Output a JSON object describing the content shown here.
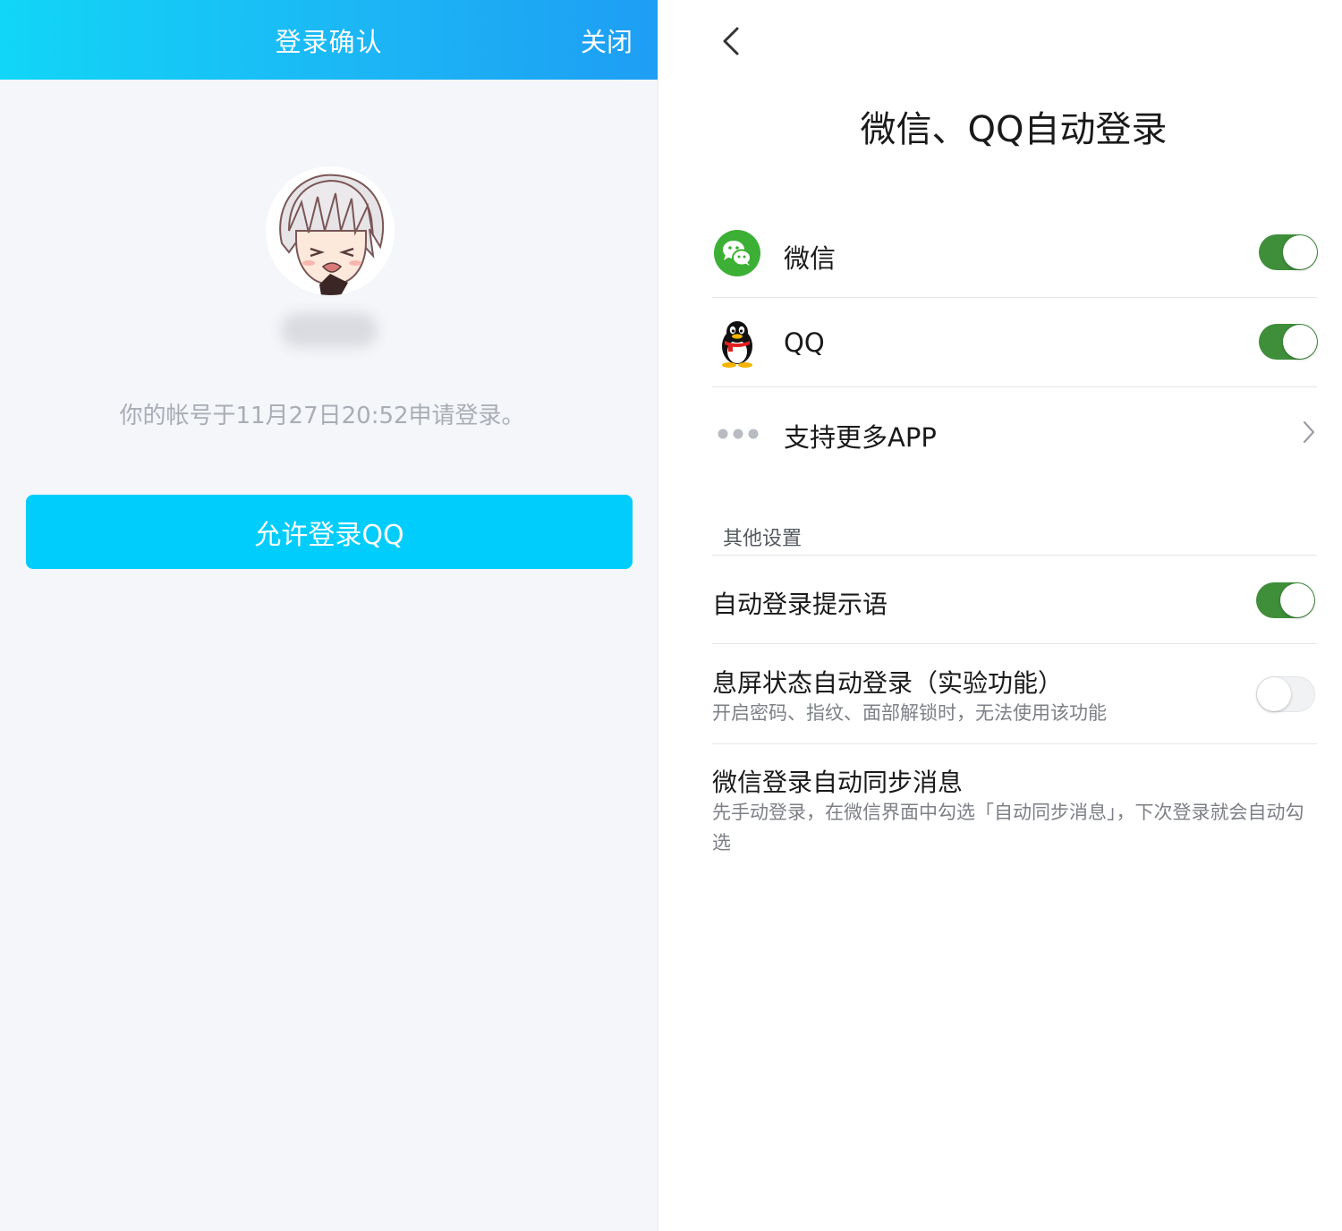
{
  "left": {
    "header_title": "登录确认",
    "close_label": "关闭",
    "request_text": "你的帐号于11月27日20:52申请登录。",
    "allow_button": "允许登录QQ"
  },
  "right": {
    "page_title": "微信、QQ自动登录",
    "apps": [
      {
        "name": "微信",
        "icon": "wechat-icon",
        "enabled": true
      },
      {
        "name": "QQ",
        "icon": "qq-penguin-icon",
        "enabled": true
      },
      {
        "name": "支持更多APP",
        "icon": "more-dots-icon"
      }
    ],
    "other_section_title": "其他设置",
    "options": [
      {
        "title": "自动登录提示语",
        "enabled": true
      },
      {
        "title": "息屏状态自动登录（实验功能）",
        "desc": "开启密码、指纹、面部解锁时，无法使用该功能",
        "enabled": false
      },
      {
        "title": "微信登录自动同步消息",
        "desc": "先手动登录，在微信界面中勾选「自动同步消息」，下次登录就会自动勾选"
      }
    ]
  },
  "colors": {
    "header_gradient_start": "#11d6f7",
    "header_gradient_end": "#1e9ef4",
    "allow_button": "#00cdfb",
    "toggle_on": "#3f8e3a",
    "wechat_green": "#3cb035"
  }
}
